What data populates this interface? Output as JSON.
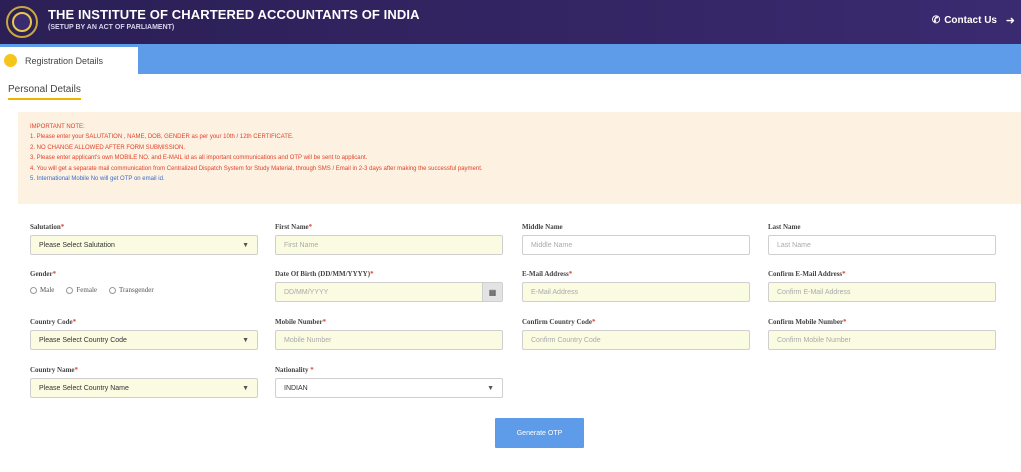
{
  "header": {
    "title": "THE INSTITUTE OF CHARTERED ACCOUNTANTS OF INDIA",
    "subtitle": "(SETUP BY AN ACT OF PARLIAMENT)",
    "contact_label": "Contact Us",
    "contact_icon": "phone-icon",
    "logout_icon": "logout-icon"
  },
  "tabs": [
    {
      "label": "Registration Details",
      "active": true
    }
  ],
  "section_heading": "Personal Details",
  "notes": {
    "heading": "IMPORTANT NOTE:",
    "lines": [
      "1. Please enter your SALUTATION , NAME, DOB, GENDER as per your 10th / 12th CERTIFICATE.",
      "2. NO CHANGE ALLOWED AFTER FORM SUBMISSION.",
      "3. Please enter applicant's own MOBILE NO. and E-MAIL id as all important communications and OTP will be sent to applicant.",
      "4. You will get a separate mail communication from Centralized Dispatch System for Study Material, through SMS / Email in 2-3 days after making the successful payment."
    ],
    "info_line": "5. International Mobile No will get OTP on email id."
  },
  "form": {
    "salutation": {
      "label": "Salutation",
      "required": "*",
      "value": "Please Select Salutation"
    },
    "first_name": {
      "label": "First Name",
      "required": "*",
      "placeholder": "First Name"
    },
    "middle_name": {
      "label": "Middle Name",
      "placeholder": "Middle Name"
    },
    "last_name": {
      "label": "Last Name",
      "placeholder": "Last Name"
    },
    "gender": {
      "label": "Gender",
      "required": "*",
      "options": [
        "Male",
        "Female",
        "Transgender"
      ]
    },
    "dob": {
      "label": "Date Of Birth (DD/MM/YYYY)",
      "required": "*",
      "placeholder": "DD/MM/YYYY"
    },
    "email": {
      "label": "E-Mail Address",
      "required": "*",
      "placeholder": "E-Mail Address"
    },
    "confirm_email": {
      "label": "Confirm E-Mail Address",
      "required": "*",
      "placeholder": "Confirm E-Mail Address"
    },
    "country_code": {
      "label": "Country Code",
      "required": "*",
      "value": "Please Select Country Code"
    },
    "mobile": {
      "label": "Mobile Number",
      "required": "*",
      "placeholder": "Mobile Number"
    },
    "confirm_country_code": {
      "label": "Confirm Country Code",
      "required": "*",
      "placeholder": "Confirm Country Code"
    },
    "confirm_mobile": {
      "label": "Confirm Mobile Number",
      "required": "*",
      "placeholder": "Confirm Mobile Number"
    },
    "country_name": {
      "label": "Country Name",
      "required": "*",
      "value": "Please Select Country Name"
    },
    "nationality": {
      "label": "Nationality",
      "required": " *",
      "value": "INDIAN"
    }
  },
  "otp_button_label": "Generate OTP",
  "colors": {
    "header_bg": "#2b1f55",
    "tab_strip": "#5e9be8",
    "accent_yellow": "#f6c51b",
    "note_red": "#e0412b",
    "note_blue": "#3a6bc9",
    "input_fill": "#fbfbe2"
  }
}
